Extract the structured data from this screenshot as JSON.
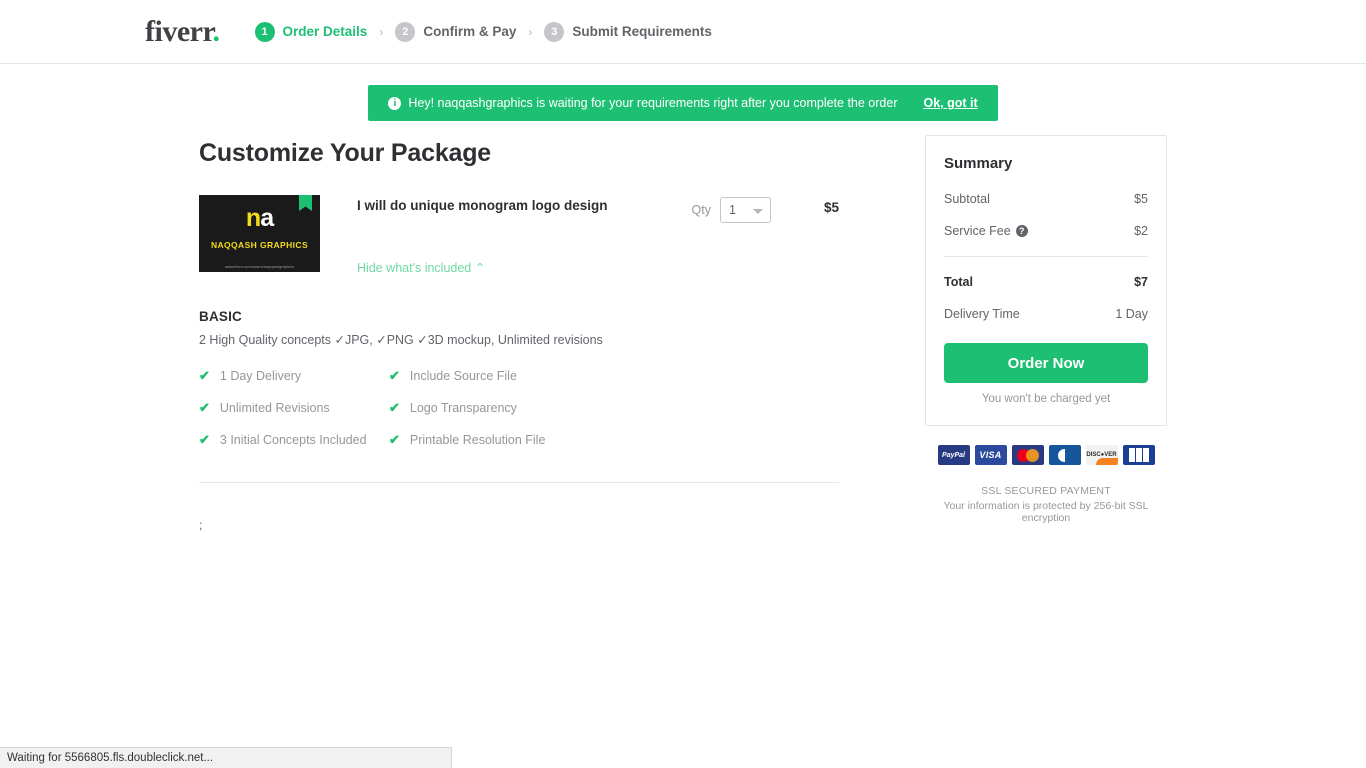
{
  "header": {
    "logo": "fiverr",
    "steps": [
      {
        "number": "1",
        "label": "Order Details",
        "state": "active"
      },
      {
        "number": "2",
        "label": "Confirm & Pay",
        "state": "inactive"
      },
      {
        "number": "3",
        "label": "Submit Requirements",
        "state": "inactive"
      }
    ],
    "separator": "›"
  },
  "notice": {
    "icon": "info-icon",
    "icon_glyph": "i",
    "text": "Hey! naqqashgraphics is waiting for your requirements right after you complete the order",
    "action": "Ok, got it",
    "background": "#1dbf73"
  },
  "main": {
    "title": "Customize Your Package",
    "gig": {
      "thumbnail": {
        "logo_mark_left": "n",
        "logo_mark_right": "a",
        "brand": "NAQQASH GRAPHICS",
        "caption": "www.fiverr.com/users/naqqashgraphics",
        "badge": "pro-badge"
      },
      "title": "I will do unique monogram logo design",
      "toggle_label": "Hide what's included",
      "toggle_caret": "⌃",
      "qty_label": "Qty",
      "qty_value": "1",
      "price": "$5"
    },
    "package": {
      "name": "BASIC",
      "description": "2 High Quality concepts ✓JPG, ✓PNG ✓3D mockup, Unlimited revisions",
      "check_glyph": "✔",
      "features": [
        "1 Day Delivery",
        "Include Source File",
        "Unlimited Revisions",
        "Logo Transparency",
        "3 Initial Concepts Included",
        "Printable Resolution File"
      ]
    },
    "stray_text": ";"
  },
  "summary": {
    "title": "Summary",
    "rows": [
      {
        "label": "Subtotal",
        "value": "$5",
        "help": false
      },
      {
        "label": "Service Fee",
        "value": "$2",
        "help": true
      }
    ],
    "help_glyph": "?",
    "total": {
      "label": "Total",
      "value": "$7"
    },
    "delivery": {
      "label": "Delivery Time",
      "value": "1 Day"
    },
    "order_button": "Order Now",
    "charge_note": "You won't be charged yet",
    "payment_methods": [
      {
        "name": "paypal",
        "label": "PayPal"
      },
      {
        "name": "visa",
        "label": "VISA"
      },
      {
        "name": "mastercard",
        "label": ""
      },
      {
        "name": "diners",
        "label": ""
      },
      {
        "name": "discover",
        "label": "DISC●VER"
      },
      {
        "name": "jcb",
        "label": ""
      }
    ],
    "ssl_title": "SSL SECURED PAYMENT",
    "ssl_sub": "Your information is protected by 256-bit SSL encryption",
    "accent_color": "#1dbf73"
  },
  "statusbar": {
    "text": "Waiting for 5566805.fls.doubleclick.net..."
  }
}
